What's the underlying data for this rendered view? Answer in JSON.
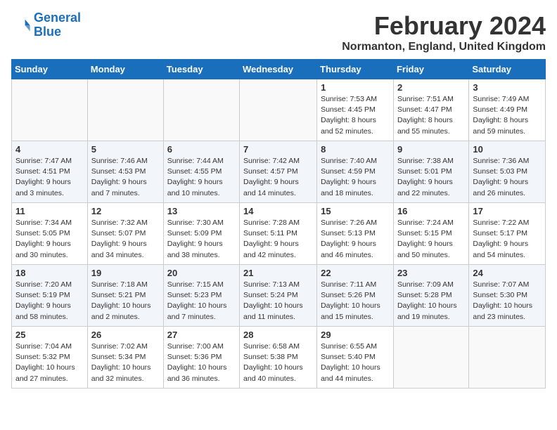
{
  "header": {
    "logo_line1": "General",
    "logo_line2": "Blue",
    "title": "February 2024",
    "subtitle": "Normanton, England, United Kingdom"
  },
  "weekdays": [
    "Sunday",
    "Monday",
    "Tuesday",
    "Wednesday",
    "Thursday",
    "Friday",
    "Saturday"
  ],
  "weeks": [
    [
      {
        "day": "",
        "detail": ""
      },
      {
        "day": "",
        "detail": ""
      },
      {
        "day": "",
        "detail": ""
      },
      {
        "day": "",
        "detail": ""
      },
      {
        "day": "1",
        "detail": "Sunrise: 7:53 AM\nSunset: 4:45 PM\nDaylight: 8 hours\nand 52 minutes."
      },
      {
        "day": "2",
        "detail": "Sunrise: 7:51 AM\nSunset: 4:47 PM\nDaylight: 8 hours\nand 55 minutes."
      },
      {
        "day": "3",
        "detail": "Sunrise: 7:49 AM\nSunset: 4:49 PM\nDaylight: 8 hours\nand 59 minutes."
      }
    ],
    [
      {
        "day": "4",
        "detail": "Sunrise: 7:47 AM\nSunset: 4:51 PM\nDaylight: 9 hours\nand 3 minutes."
      },
      {
        "day": "5",
        "detail": "Sunrise: 7:46 AM\nSunset: 4:53 PM\nDaylight: 9 hours\nand 7 minutes."
      },
      {
        "day": "6",
        "detail": "Sunrise: 7:44 AM\nSunset: 4:55 PM\nDaylight: 9 hours\nand 10 minutes."
      },
      {
        "day": "7",
        "detail": "Sunrise: 7:42 AM\nSunset: 4:57 PM\nDaylight: 9 hours\nand 14 minutes."
      },
      {
        "day": "8",
        "detail": "Sunrise: 7:40 AM\nSunset: 4:59 PM\nDaylight: 9 hours\nand 18 minutes."
      },
      {
        "day": "9",
        "detail": "Sunrise: 7:38 AM\nSunset: 5:01 PM\nDaylight: 9 hours\nand 22 minutes."
      },
      {
        "day": "10",
        "detail": "Sunrise: 7:36 AM\nSunset: 5:03 PM\nDaylight: 9 hours\nand 26 minutes."
      }
    ],
    [
      {
        "day": "11",
        "detail": "Sunrise: 7:34 AM\nSunset: 5:05 PM\nDaylight: 9 hours\nand 30 minutes."
      },
      {
        "day": "12",
        "detail": "Sunrise: 7:32 AM\nSunset: 5:07 PM\nDaylight: 9 hours\nand 34 minutes."
      },
      {
        "day": "13",
        "detail": "Sunrise: 7:30 AM\nSunset: 5:09 PM\nDaylight: 9 hours\nand 38 minutes."
      },
      {
        "day": "14",
        "detail": "Sunrise: 7:28 AM\nSunset: 5:11 PM\nDaylight: 9 hours\nand 42 minutes."
      },
      {
        "day": "15",
        "detail": "Sunrise: 7:26 AM\nSunset: 5:13 PM\nDaylight: 9 hours\nand 46 minutes."
      },
      {
        "day": "16",
        "detail": "Sunrise: 7:24 AM\nSunset: 5:15 PM\nDaylight: 9 hours\nand 50 minutes."
      },
      {
        "day": "17",
        "detail": "Sunrise: 7:22 AM\nSunset: 5:17 PM\nDaylight: 9 hours\nand 54 minutes."
      }
    ],
    [
      {
        "day": "18",
        "detail": "Sunrise: 7:20 AM\nSunset: 5:19 PM\nDaylight: 9 hours\nand 58 minutes."
      },
      {
        "day": "19",
        "detail": "Sunrise: 7:18 AM\nSunset: 5:21 PM\nDaylight: 10 hours\nand 2 minutes."
      },
      {
        "day": "20",
        "detail": "Sunrise: 7:15 AM\nSunset: 5:23 PM\nDaylight: 10 hours\nand 7 minutes."
      },
      {
        "day": "21",
        "detail": "Sunrise: 7:13 AM\nSunset: 5:24 PM\nDaylight: 10 hours\nand 11 minutes."
      },
      {
        "day": "22",
        "detail": "Sunrise: 7:11 AM\nSunset: 5:26 PM\nDaylight: 10 hours\nand 15 minutes."
      },
      {
        "day": "23",
        "detail": "Sunrise: 7:09 AM\nSunset: 5:28 PM\nDaylight: 10 hours\nand 19 minutes."
      },
      {
        "day": "24",
        "detail": "Sunrise: 7:07 AM\nSunset: 5:30 PM\nDaylight: 10 hours\nand 23 minutes."
      }
    ],
    [
      {
        "day": "25",
        "detail": "Sunrise: 7:04 AM\nSunset: 5:32 PM\nDaylight: 10 hours\nand 27 minutes."
      },
      {
        "day": "26",
        "detail": "Sunrise: 7:02 AM\nSunset: 5:34 PM\nDaylight: 10 hours\nand 32 minutes."
      },
      {
        "day": "27",
        "detail": "Sunrise: 7:00 AM\nSunset: 5:36 PM\nDaylight: 10 hours\nand 36 minutes."
      },
      {
        "day": "28",
        "detail": "Sunrise: 6:58 AM\nSunset: 5:38 PM\nDaylight: 10 hours\nand 40 minutes."
      },
      {
        "day": "29",
        "detail": "Sunrise: 6:55 AM\nSunset: 5:40 PM\nDaylight: 10 hours\nand 44 minutes."
      },
      {
        "day": "",
        "detail": ""
      },
      {
        "day": "",
        "detail": ""
      }
    ]
  ]
}
